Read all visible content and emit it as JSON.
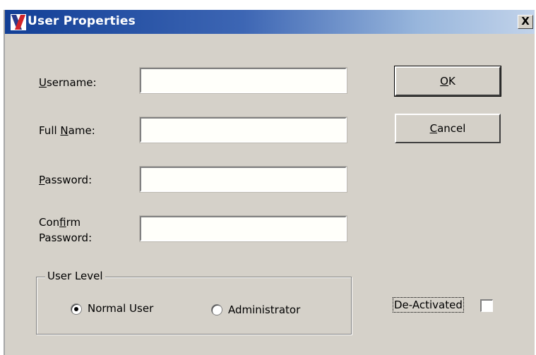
{
  "window": {
    "title": "User Properties",
    "close_glyph": "X",
    "icon": "app-x-icon",
    "titlebar_color": "#123f96"
  },
  "form": {
    "username": {
      "label_mnemonic": "U",
      "label_rest": "sername:",
      "value": ""
    },
    "full_name": {
      "label_pre": "Full ",
      "label_mnemonic": "N",
      "label_rest": "ame:",
      "value": ""
    },
    "password": {
      "label_mnemonic": "P",
      "label_rest": "assword:",
      "value": ""
    },
    "confirm_password": {
      "label_line1_pre": "Con",
      "label_line1_mnemonic": "f",
      "label_line1_rest": "irm",
      "label_line2": "Password:",
      "value": ""
    }
  },
  "buttons": {
    "ok": {
      "mnemonic": "O",
      "rest": "K"
    },
    "cancel": {
      "mnemonic": "C",
      "rest": "ancel"
    }
  },
  "user_level": {
    "legend": "User Level",
    "options": [
      {
        "label": "Normal User",
        "selected": true
      },
      {
        "label": "Administrator",
        "selected": false
      }
    ]
  },
  "deactivated": {
    "label": "De-Activated",
    "checked": false
  }
}
